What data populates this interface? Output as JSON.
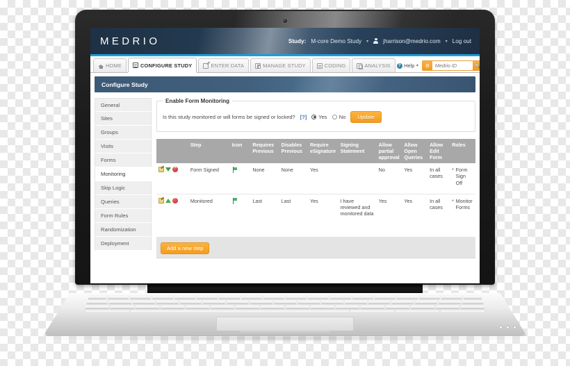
{
  "app": {
    "logo": "MEDRIO",
    "accent_color": "#1b9dd9",
    "header_color": "#233a50",
    "orange": "#f59b1d"
  },
  "header": {
    "study_label": "Study:",
    "study_name": "M-core Demo Study",
    "study_caret": "▾",
    "user_email": "jharrison@medrio.com",
    "user_caret": "▾",
    "logout": "Log out"
  },
  "tabs": [
    {
      "label": "HOME",
      "icon": "home-icon",
      "active": false
    },
    {
      "label": "CONFIGURE STUDY",
      "icon": "list-icon",
      "active": true
    },
    {
      "label": "ENTER DATA",
      "icon": "pencil-icon",
      "active": false
    },
    {
      "label": "MANAGE STUDY",
      "icon": "grid-icon",
      "active": false
    },
    {
      "label": "CODING",
      "icon": "bars-icon",
      "active": false
    },
    {
      "label": "ANALYSIS",
      "icon": "document-icon",
      "active": false
    }
  ],
  "tools": {
    "help_label": "Help",
    "help_caret": "▾",
    "help_badge": "?",
    "gear_icon": "gear-icon",
    "search_placeholder": "Medrio ID",
    "search_value": "",
    "search_icon": "search-icon"
  },
  "page": {
    "title": "Configure Study"
  },
  "sidebar": {
    "items": [
      {
        "label": "General",
        "active": false
      },
      {
        "label": "Sites",
        "active": false
      },
      {
        "label": "Groups",
        "active": false
      },
      {
        "label": "Visits",
        "active": false
      },
      {
        "label": "Forms",
        "active": false
      },
      {
        "label": "Monitoring",
        "active": true
      },
      {
        "label": "Skip Logic",
        "active": false
      },
      {
        "label": "Queries",
        "active": false
      },
      {
        "label": "Form Rules",
        "active": false
      },
      {
        "label": "Randomization",
        "active": false
      },
      {
        "label": "Deployment",
        "active": false
      }
    ]
  },
  "monitoring": {
    "legend": "Enable Form Monitoring",
    "question": "Is this study monitored or will forms be signed or locked?",
    "help_link": "[?]",
    "option_yes": "Yes",
    "option_no": "No",
    "selected": "Yes",
    "update_button": "Update"
  },
  "table": {
    "columns": [
      "",
      "Step",
      "Icon",
      "Requires Previous",
      "Disables Previous",
      "Require eSignature",
      "Signing Statement",
      "Allow partial approval",
      "Allow Open Queries",
      "Allow Edit Form",
      "Roles"
    ],
    "rows": [
      {
        "actions": [
          "edit-icon",
          "move-down-icon",
          "delete-icon"
        ],
        "step": "Form Signed",
        "icon": "green-flag-icon",
        "requires_previous": "None",
        "disables_previous": "None",
        "require_esignature": "Yes",
        "signing_statement": "",
        "allow_partial_approval": "No",
        "allow_open_queries": "Yes",
        "allow_edit_form": "In all cases",
        "roles": [
          "Form Sign Off"
        ]
      },
      {
        "actions": [
          "edit-icon",
          "move-up-icon",
          "delete-icon"
        ],
        "step": "Monitored",
        "icon": "green-flag-icon",
        "requires_previous": "Last",
        "disables_previous": "Last",
        "require_esignature": "Yes",
        "signing_statement": "I have reviewed and monitored data",
        "allow_partial_approval": "Yes",
        "allow_open_queries": "Yes",
        "allow_edit_form": "In all cases",
        "roles": [
          "Monitor Forms"
        ]
      }
    ],
    "add_button": "Add a new step"
  }
}
